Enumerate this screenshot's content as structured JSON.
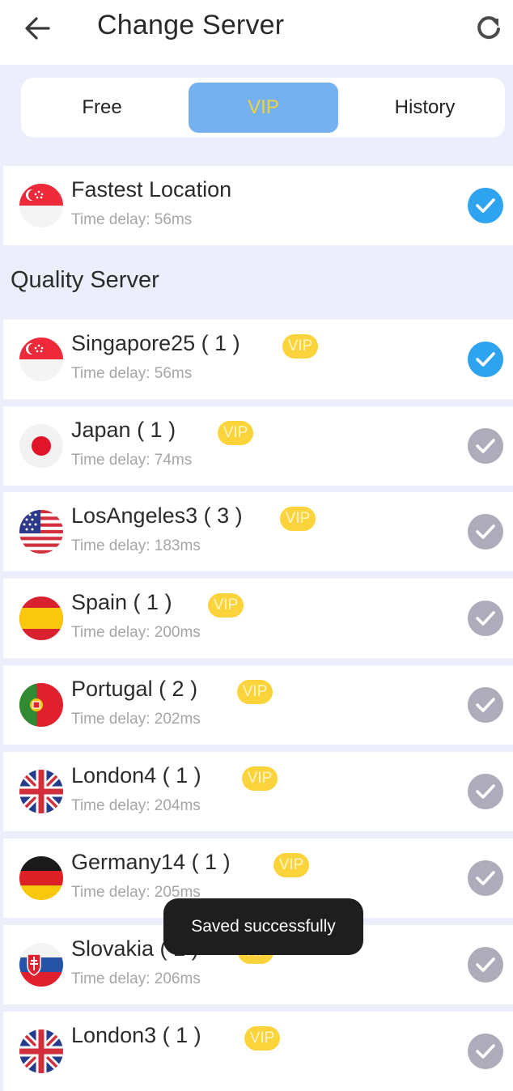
{
  "header": {
    "title": "Change Server",
    "back_icon": "arrow-left-icon",
    "refresh_icon": "refresh-icon"
  },
  "tabs": [
    {
      "label": "Free",
      "active": false
    },
    {
      "label": "VIP",
      "active": true
    },
    {
      "label": "History",
      "active": false
    }
  ],
  "fastest": {
    "name": "Fastest Location",
    "delay": "Time delay: 56ms",
    "flag": "singapore-flag-icon",
    "selected": true
  },
  "section_title": "Quality Server",
  "servers": [
    {
      "name": "Singapore25 ( 1 )",
      "badge": "VIP",
      "delay": "Time delay: 56ms",
      "flag": "singapore-flag-icon",
      "selected": true
    },
    {
      "name": "Japan ( 1 )",
      "badge": "VIP",
      "delay": "Time delay: 74ms",
      "flag": "japan-flag-icon",
      "selected": false
    },
    {
      "name": "LosAngeles3 ( 3 )",
      "badge": "VIP",
      "delay": "Time delay: 183ms",
      "flag": "usa-flag-icon",
      "selected": false
    },
    {
      "name": "Spain ( 1 )",
      "badge": "VIP",
      "delay": "Time delay: 200ms",
      "flag": "spain-flag-icon",
      "selected": false
    },
    {
      "name": "Portugal ( 2 )",
      "badge": "VIP",
      "delay": "Time delay: 202ms",
      "flag": "portugal-flag-icon",
      "selected": false
    },
    {
      "name": "London4 ( 1 )",
      "badge": "VIP",
      "delay": "Time delay: 204ms",
      "flag": "uk-flag-icon",
      "selected": false
    },
    {
      "name": "Germany14 ( 1 )",
      "badge": "VIP",
      "delay": "Time delay: 205ms",
      "flag": "germany-flag-icon",
      "selected": false
    },
    {
      "name": "Slovakia ( 1 )",
      "badge": "VIP",
      "delay": "Time delay: 206ms",
      "flag": "slovakia-flag-icon",
      "selected": false
    },
    {
      "name": "London3 ( 1 )",
      "badge": "VIP",
      "delay": "",
      "flag": "uk-flag-icon",
      "selected": false
    }
  ],
  "toast": "Saved successfully",
  "colors": {
    "accent_blue": "#2ea3f0",
    "tab_active_bg": "#75b1f0",
    "vip_badge": "#fbd33a",
    "check_off": "#aeacbb",
    "page_bg": "#eceffb"
  }
}
